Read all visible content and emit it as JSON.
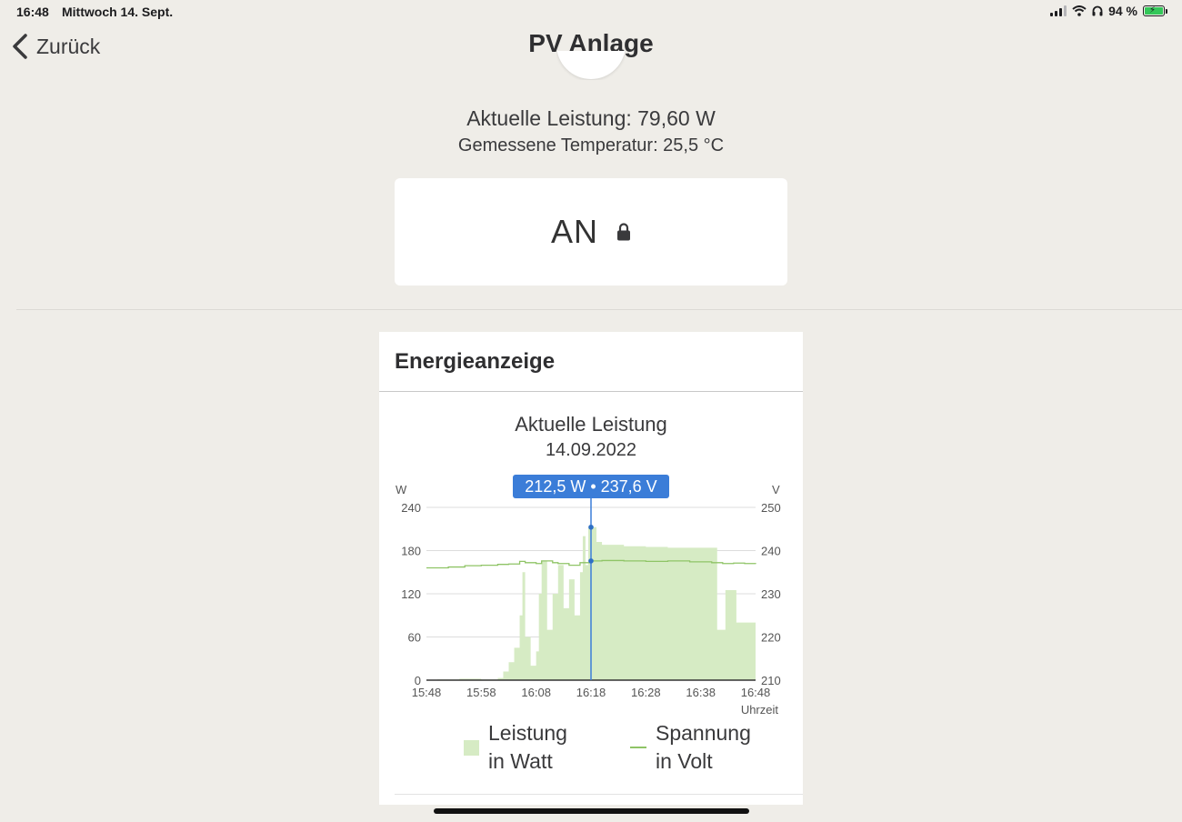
{
  "status_bar": {
    "time": "16:48",
    "date": "Mittwoch 14. Sept.",
    "battery_percent": "94 %",
    "icons": [
      "cellular-signal-icon",
      "wifi-icon",
      "headphones-icon",
      "battery-charging-icon"
    ]
  },
  "nav": {
    "back_label": "Zurück",
    "title": "PV Anlage"
  },
  "device": {
    "current_power": "Aktuelle Leistung: 79,60 W",
    "temperature": "Gemessene Temperatur: 25,5 °C",
    "switch_state": "AN",
    "switch_icon": "lock-icon"
  },
  "energy": {
    "section_title": "Energieanzeige",
    "chart_title": "Aktuelle Leistung",
    "chart_date": "14.09.2022",
    "tooltip": "212,5 W • 237,6 V",
    "legend": {
      "power_line1": "Leistung",
      "power_line2": "in Watt",
      "voltage_line1": "Spannung",
      "voltage_line2": "in Volt"
    }
  },
  "colors": {
    "background": "#efede8",
    "power_fill": "#d6ebc4",
    "voltage_line": "#8fc466",
    "tooltip_bg": "#3b7dd8",
    "cursor": "#3b7dd8"
  },
  "chart_data": {
    "type": "area",
    "title": "Aktuelle Leistung",
    "subtitle": "14.09.2022",
    "xlabel": "Uhrzeit",
    "x_ticks": [
      "15:48",
      "15:58",
      "16:08",
      "16:18",
      "16:28",
      "16:38",
      "16:48"
    ],
    "y_left": {
      "label": "W",
      "ticks": [
        "0",
        "60",
        "120",
        "180",
        "240"
      ],
      "range": [
        0,
        240
      ]
    },
    "y_right": {
      "label": "V",
      "ticks": [
        "210",
        "220",
        "230",
        "240",
        "250"
      ],
      "range": [
        210,
        250
      ]
    },
    "legend_position": "bottom",
    "cursor": {
      "time": "16:18",
      "power_w": 212.5,
      "voltage_v": 237.6
    },
    "series": [
      {
        "name": "Leistung in Watt",
        "kind": "area",
        "axis": "left",
        "points": [
          [
            "15:48",
            0
          ],
          [
            "15:50",
            1
          ],
          [
            "15:54",
            2
          ],
          [
            "15:58",
            1
          ],
          [
            "16:01",
            3
          ],
          [
            "16:02",
            12
          ],
          [
            "16:03",
            25
          ],
          [
            "16:04",
            45
          ],
          [
            "16:05",
            90
          ],
          [
            "16:05.5",
            150
          ],
          [
            "16:06",
            60
          ],
          [
            "16:07",
            20
          ],
          [
            "16:08",
            40
          ],
          [
            "16:08.5",
            120
          ],
          [
            "16:09",
            165
          ],
          [
            "16:10",
            70
          ],
          [
            "16:11",
            120
          ],
          [
            "16:12",
            160
          ],
          [
            "16:13",
            100
          ],
          [
            "16:14",
            140
          ],
          [
            "16:15",
            90
          ],
          [
            "16:16",
            150
          ],
          [
            "16:16.5",
            200
          ],
          [
            "16:17",
            160
          ],
          [
            "16:17.5",
            212
          ],
          [
            "16:18",
            212.5
          ],
          [
            "16:19",
            192
          ],
          [
            "16:20",
            188
          ],
          [
            "16:24",
            186
          ],
          [
            "16:28",
            185
          ],
          [
            "16:32",
            184
          ],
          [
            "16:36",
            184
          ],
          [
            "16:40",
            184
          ],
          [
            "16:41",
            70
          ],
          [
            "16:42.5",
            125
          ],
          [
            "16:44.5",
            80
          ],
          [
            "16:48",
            80
          ]
        ]
      },
      {
        "name": "Spannung in Volt",
        "kind": "line",
        "axis": "right",
        "points": [
          [
            "15:48",
            236.0
          ],
          [
            "15:52",
            236.2
          ],
          [
            "15:55",
            236.5
          ],
          [
            "15:58",
            236.6
          ],
          [
            "16:01",
            236.8
          ],
          [
            "16:03",
            236.9
          ],
          [
            "16:05",
            237.5
          ],
          [
            "16:06",
            237.2
          ],
          [
            "16:08",
            237.0
          ],
          [
            "16:09",
            237.6
          ],
          [
            "16:11",
            237.2
          ],
          [
            "16:12",
            237.0
          ],
          [
            "16:14",
            236.6
          ],
          [
            "16:16",
            237.2
          ],
          [
            "16:18",
            237.6
          ],
          [
            "16:20",
            237.7
          ],
          [
            "16:24",
            237.6
          ],
          [
            "16:28",
            237.5
          ],
          [
            "16:32",
            237.6
          ],
          [
            "16:36",
            237.4
          ],
          [
            "16:40",
            237.2
          ],
          [
            "16:42",
            237.0
          ],
          [
            "16:44",
            237.1
          ],
          [
            "16:46",
            237.0
          ],
          [
            "16:48",
            236.9
          ]
        ]
      }
    ]
  }
}
